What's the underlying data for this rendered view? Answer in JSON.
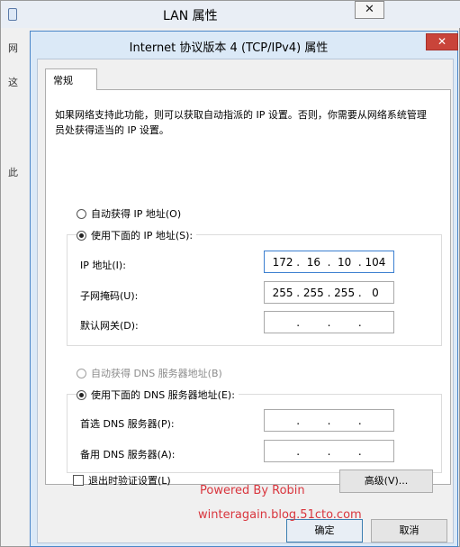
{
  "background_window": {
    "title": "LAN 属性",
    "close_glyph": "✕",
    "fragments": [
      "网",
      "这",
      "此"
    ]
  },
  "dialog": {
    "title": "Internet 协议版本 4 (TCP/IPv4) 属性",
    "close_glyph": "✕",
    "tab_label": "常规",
    "description": "如果网络支持此功能，则可以获取自动指派的 IP 设置。否则，你需要从网络系统管理员处获得适当的 IP 设置。",
    "ip_section": {
      "auto_option": "自动获得 IP 地址(O)",
      "manual_option": "使用下面的 IP 地址(S):",
      "selected": "manual",
      "fields": [
        {
          "label": "IP 地址(I):",
          "octets": [
            "172",
            "16",
            "10",
            "104"
          ]
        },
        {
          "label": "子网掩码(U):",
          "octets": [
            "255",
            "255",
            "255",
            "0"
          ]
        },
        {
          "label": "默认网关(D):",
          "octets": [
            "",
            "",
            "",
            ""
          ]
        }
      ]
    },
    "dns_section": {
      "auto_option": "自动获得 DNS 服务器地址(B)",
      "manual_option": "使用下面的 DNS 服务器地址(E):",
      "selected": "manual",
      "fields": [
        {
          "label": "首选 DNS 服务器(P):",
          "octets": [
            "",
            "",
            "",
            ""
          ]
        },
        {
          "label": "备用 DNS 服务器(A):",
          "octets": [
            "",
            "",
            "",
            ""
          ]
        }
      ]
    },
    "validate_checkbox": {
      "label": "退出时验证设置(L)",
      "checked": false
    },
    "advanced_button": "高级(V)...",
    "ok_button": "确定",
    "cancel_button": "取消"
  },
  "watermark": {
    "line1": "Powered By Robin",
    "line2": "winteragain.blog.51cto.com",
    "color": "#d9363e"
  },
  "colors": {
    "dialog_border": "#4a86c8",
    "close_button": "#c9443a"
  }
}
